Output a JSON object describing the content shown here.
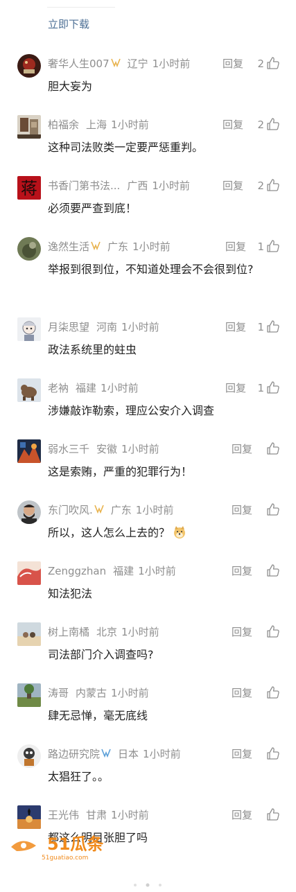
{
  "download_label": "立即下载",
  "actions": {
    "reply_label": "回复"
  },
  "comments": [
    {
      "name": "奢华人生007",
      "badge": true,
      "badge_color": "#e8b24c",
      "location": "辽宁",
      "time": "1小时前",
      "likes": "2",
      "text": "胆大妄为",
      "avatar": "avatar-dark-red-cup"
    },
    {
      "name": "柏福余",
      "location": "上海",
      "time": "1小时前",
      "likes": "2",
      "text": "这种司法败类一定要严惩重判。",
      "avatar": "avatar-room-photo"
    },
    {
      "name": "书香门第书法...",
      "location": "广西",
      "time": "1小时前",
      "likes": "2",
      "text": "必须要严查到底！",
      "avatar": "avatar-calligraphy-char",
      "avatar_char": "蒋"
    },
    {
      "name": "逸然生活",
      "badge": true,
      "badge_color": "#e8b24c",
      "location": "广东",
      "time": "1小时前",
      "likes": "1",
      "text": "举报到很到位，不知道处理会不会很到位?",
      "avatar": "avatar-nature"
    },
    {
      "name": "月柒思望",
      "location": "河南",
      "time": "1小时前",
      "likes": "1",
      "text": "政法系统里的蛀虫",
      "avatar": "avatar-anime"
    },
    {
      "name": "老衲",
      "location": "福建",
      "time": "1小时前",
      "likes": "1",
      "text": "涉嫌敲诈勒索，理应公安介入调查",
      "avatar": "avatar-elephant"
    },
    {
      "name": "弱水三千",
      "location": "安徽",
      "time": "1小时前",
      "likes": "",
      "text": "这是索贿，严重的犯罪行为！",
      "avatar": "avatar-fire-art"
    },
    {
      "name": "东门吹风.",
      "badge": true,
      "badge_color": "#e8b24c",
      "location": "广东",
      "time": "1小时前",
      "likes": "",
      "text": "所以，这人怎么上去的？",
      "emoji": "doge-emoji",
      "avatar": "avatar-man"
    },
    {
      "name": "Zenggzhan",
      "location": "福建",
      "time": "1小时前",
      "likes": "",
      "text": "知法犯法",
      "avatar": "avatar-wave"
    },
    {
      "name": "树上南橘",
      "location": "北京",
      "time": "1小时前",
      "likes": "",
      "text": "司法部门介入调查吗?",
      "avatar": "avatar-beach"
    },
    {
      "name": "涛哥",
      "location": "内蒙古",
      "time": "1小时前",
      "likes": "",
      "text": "肆无忌惮，毫无底线",
      "avatar": "avatar-landscape"
    },
    {
      "name": "路边研究院",
      "badge": true,
      "badge_color": "#5a9fd8",
      "location": "日本",
      "time": "1小时前",
      "likes": "",
      "text": "太猖狂了。。",
      "avatar": "avatar-cartoon"
    },
    {
      "name": "王光伟",
      "location": "甘肃",
      "time": "1小时前",
      "likes": "",
      "text": "都这么明目张胆了吗",
      "avatar": "avatar-sunset"
    }
  ],
  "watermark": {
    "brand": "51瓜条",
    "url": "51guatiao.com",
    "color": "#f08a1c"
  },
  "colors": {
    "link": "#4c6f95",
    "meta": "#8e8e8e",
    "text": "#222222"
  }
}
